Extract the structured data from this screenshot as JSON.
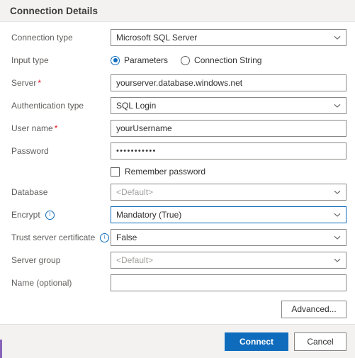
{
  "dialog": {
    "title": "Connection Details",
    "accent_color": "#8764b8",
    "primary_color": "#0f6cbd",
    "required_color": "#e81123"
  },
  "fields": {
    "connection_type": {
      "label": "Connection type",
      "value": "Microsoft SQL Server",
      "type": "dropdown"
    },
    "input_type": {
      "label": "Input type",
      "options": [
        {
          "label": "Parameters",
          "selected": true
        },
        {
          "label": "Connection String",
          "selected": false
        }
      ]
    },
    "server": {
      "label": "Server",
      "required": "*",
      "value": "yourserver.database.windows.net",
      "type": "text"
    },
    "authentication_type": {
      "label": "Authentication type",
      "value": "SQL Login",
      "type": "dropdown"
    },
    "user_name": {
      "label": "User name",
      "required": "*",
      "value": "yourUsername",
      "type": "text"
    },
    "password": {
      "label": "Password",
      "value": "•••••••••••",
      "type": "password"
    },
    "remember_password": {
      "label": "Remember password",
      "checked": false
    },
    "database": {
      "label": "Database",
      "value": "<Default>",
      "is_placeholder": true,
      "type": "dropdown"
    },
    "encrypt": {
      "label": "Encrypt",
      "info": "i",
      "value": "Mandatory (True)",
      "type": "dropdown",
      "focused": true
    },
    "trust_server_certificate": {
      "label": "Trust server certificate",
      "info": "i",
      "value": "False",
      "type": "dropdown"
    },
    "server_group": {
      "label": "Server group",
      "value": "<Default>",
      "is_placeholder": true,
      "type": "dropdown"
    },
    "name_optional": {
      "label": "Name (optional)",
      "value": "",
      "type": "text"
    }
  },
  "buttons": {
    "advanced": "Advanced...",
    "connect": "Connect",
    "cancel": "Cancel"
  }
}
